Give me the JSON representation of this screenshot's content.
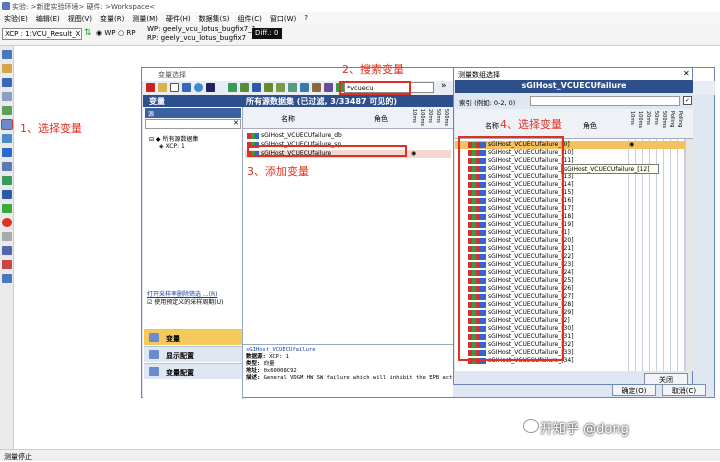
{
  "window": {
    "title": "实验: >新建实验环境> 硬件: >Workspace<"
  },
  "menu": [
    "实验(E)",
    "编辑(E)",
    "视图(V)",
    "变量(R)",
    "测量(M)",
    "硬件(H)",
    "数据集(S)",
    "组件(C)",
    "窗口(W)",
    "?"
  ],
  "toolbar": {
    "xcp_select": "XCP : 1:VCU_Result_X",
    "wp_label": "WP",
    "rp_label": "RP",
    "wp_value": "WP: geely_vcu_lotus_bugfix7_1",
    "rp_value": "RP: geely_vcu_lotus_bugfix7",
    "diff_label": "Diff.: 0"
  },
  "status": {
    "text": "测量停止"
  },
  "var_dialog": {
    "title": "变量选择",
    "search_value": "*vcuecu",
    "left_header": "变量",
    "search_label": "源",
    "tree": [
      "所有源数据集",
      "XCP: 1"
    ],
    "filter_link": "打开采样率删除筛选 ...(R)",
    "use_default_rate": "使用预定义的采样周期(U)",
    "nav": [
      "变量",
      "显示配置",
      "变量配置"
    ],
    "right_header": "所有源数据集 (已过滤, 3/33487 可见的)",
    "col_name": "名称",
    "col_role": "角色",
    "rate_cols": [
      "10ms",
      "100ms",
      "20ms",
      "50ms",
      "500ms"
    ],
    "rows": [
      "sGIHost_VCUECUfailure_db",
      "sGIHost_VCUECUfailure_sp",
      "sGIHost_VCUECUfailure"
    ],
    "detail": {
      "title": "sGIHost_VCUECUfailure",
      "rows": [
        {
          "k": "数据源:",
          "v": "XCP: 1"
        },
        {
          "k": "类型:",
          "v": "向量"
        },
        {
          "k": "地址:",
          "v": "0x60008C92"
        },
        {
          "k": "描述:",
          "v": "General VDGM HW SW failure which will inhibit the EPB actuat"
        }
      ]
    },
    "ok": "确定(O)",
    "cancel": "取消(C)"
  },
  "meas_dialog": {
    "title": "测量数组选择",
    "header": "sGIHost_VCUECUfailure",
    "index_label": "索引 (例如: 0-2, 0)",
    "col_name": "名称",
    "col_role": "角色",
    "rate_cols": [
      "10ms",
      "100ms",
      "20ms",
      "50ms",
      "500ms",
      "Polling",
      "Polling"
    ],
    "rows": [
      "sGIHost_VCUECUfailure_[0]",
      "sGIHost_VCUECUfailure_[10]",
      "sGIHost_VCUECUfailure_[11]",
      "sGIHost_VCUECUfailure_[12]",
      "sGIHost_VCUECUfailure_[13]",
      "sGIHost_VCUECUfailure_[14]",
      "sGIHost_VCUECUfailure_[15]",
      "sGIHost_VCUECUfailure_[16]",
      "sGIHost_VCUECUfailure_[17]",
      "sGIHost_VCUECUfailure_[18]",
      "sGIHost_VCUECUfailure_[19]",
      "sGIHost_VCUECUfailure_[1]",
      "sGIHost_VCUECUfailure_[20]",
      "sGIHost_VCUECUfailure_[21]",
      "sGIHost_VCUECUfailure_[22]",
      "sGIHost_VCUECUfailure_[23]",
      "sGIHost_VCUECUfailure_[24]",
      "sGIHost_VCUECUfailure_[25]",
      "sGIHost_VCUECUfailure_[26]",
      "sGIHost_VCUECUfailure_[27]",
      "sGIHost_VCUECUfailure_[28]",
      "sGIHost_VCUECUfailure_[29]",
      "sGIHost_VCUECUfailure_[2]",
      "sGIHost_VCUECUfailure_[30]",
      "sGIHost_VCUECUfailure_[31]",
      "sGIHost_VCUECUfailure_[32]",
      "sGIHost_VCUECUfailure_[33]",
      "sGIHost_VCUECUfailure_[34]"
    ],
    "tooltip": "sGIHost_VCUECUfailure_[12]",
    "close": "关闭"
  },
  "annotations": {
    "a1": "1、选择变量",
    "a2": "2、搜索变量",
    "a3": "3、添加变量",
    "a4": "4、选择变量"
  },
  "watermark": "开知乎 @dong"
}
